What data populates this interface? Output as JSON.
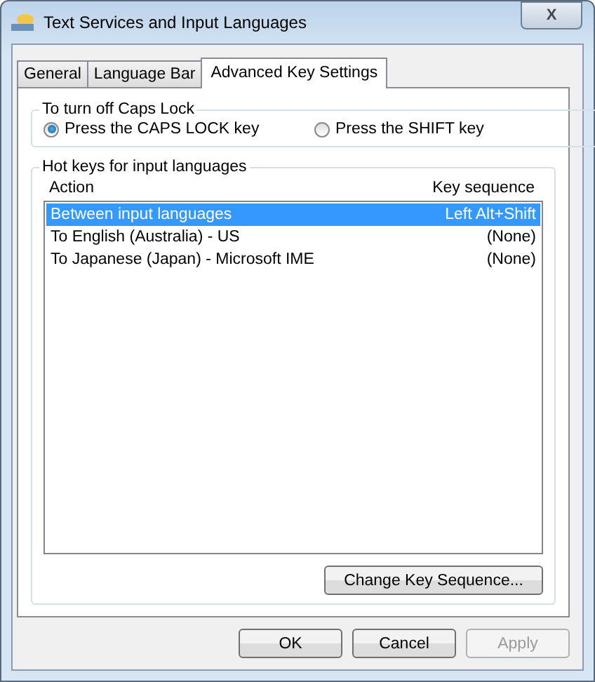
{
  "window": {
    "title": "Text Services and Input Languages",
    "close": "X"
  },
  "tabs": [
    {
      "label": "General",
      "selected": false
    },
    {
      "label": "Language Bar",
      "selected": false
    },
    {
      "label": "Advanced Key Settings",
      "selected": true
    }
  ],
  "caps_lock": {
    "title": "To turn off Caps Lock",
    "options": [
      {
        "label": "Press the CAPS LOCK key",
        "selected": true
      },
      {
        "label": "Press the SHIFT key",
        "selected": false
      }
    ]
  },
  "hot_keys": {
    "title": "Hot keys for input languages",
    "columns": [
      "Action",
      "Key sequence"
    ],
    "rows": [
      {
        "action": "Between input languages",
        "key": "Left Alt+Shift",
        "selected": true
      },
      {
        "action": "To English (Australia) - US",
        "key": "(None)",
        "selected": false
      },
      {
        "action": "To Japanese (Japan) - Microsoft IME",
        "key": "(None)",
        "selected": false
      }
    ],
    "button": "Change Key Sequence..."
  },
  "buttons": [
    {
      "label": "OK",
      "disabled": false
    },
    {
      "label": "Cancel",
      "disabled": false
    },
    {
      "label": "Apply",
      "disabled": true
    }
  ]
}
